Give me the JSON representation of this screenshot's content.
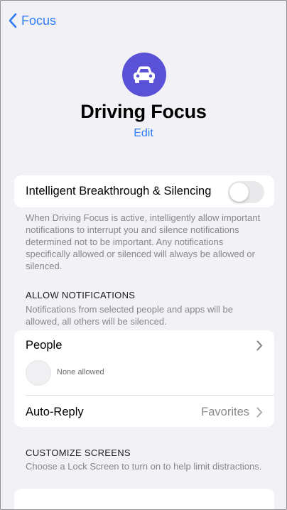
{
  "nav": {
    "back_label": "Focus"
  },
  "header": {
    "icon": "car-icon",
    "title": "Driving Focus",
    "edit_label": "Edit"
  },
  "breakthrough": {
    "label": "Intelligent Breakthrough & Silencing",
    "enabled": false,
    "footnote": "When Driving Focus is active, intelligently allow important notifications to interrupt you and silence notifications determined not to be important. Any notifications specifically allowed or silenced will always be allowed or silenced."
  },
  "allow_notifications": {
    "header": "ALLOW NOTIFICATIONS",
    "description": "Notifications from selected people and apps will be allowed, all others will be silenced.",
    "people_label": "People",
    "people_status": "None allowed",
    "auto_reply_label": "Auto-Reply",
    "auto_reply_value": "Favorites"
  },
  "customize_screens": {
    "header": "CUSTOMIZE SCREENS",
    "description": "Choose a Lock Screen to turn on to help limit distractions."
  },
  "colors": {
    "accent": "#2f7cf6",
    "icon_background": "#5a52d6",
    "background": "#f2f2f6",
    "secondary_text": "#86868b"
  }
}
